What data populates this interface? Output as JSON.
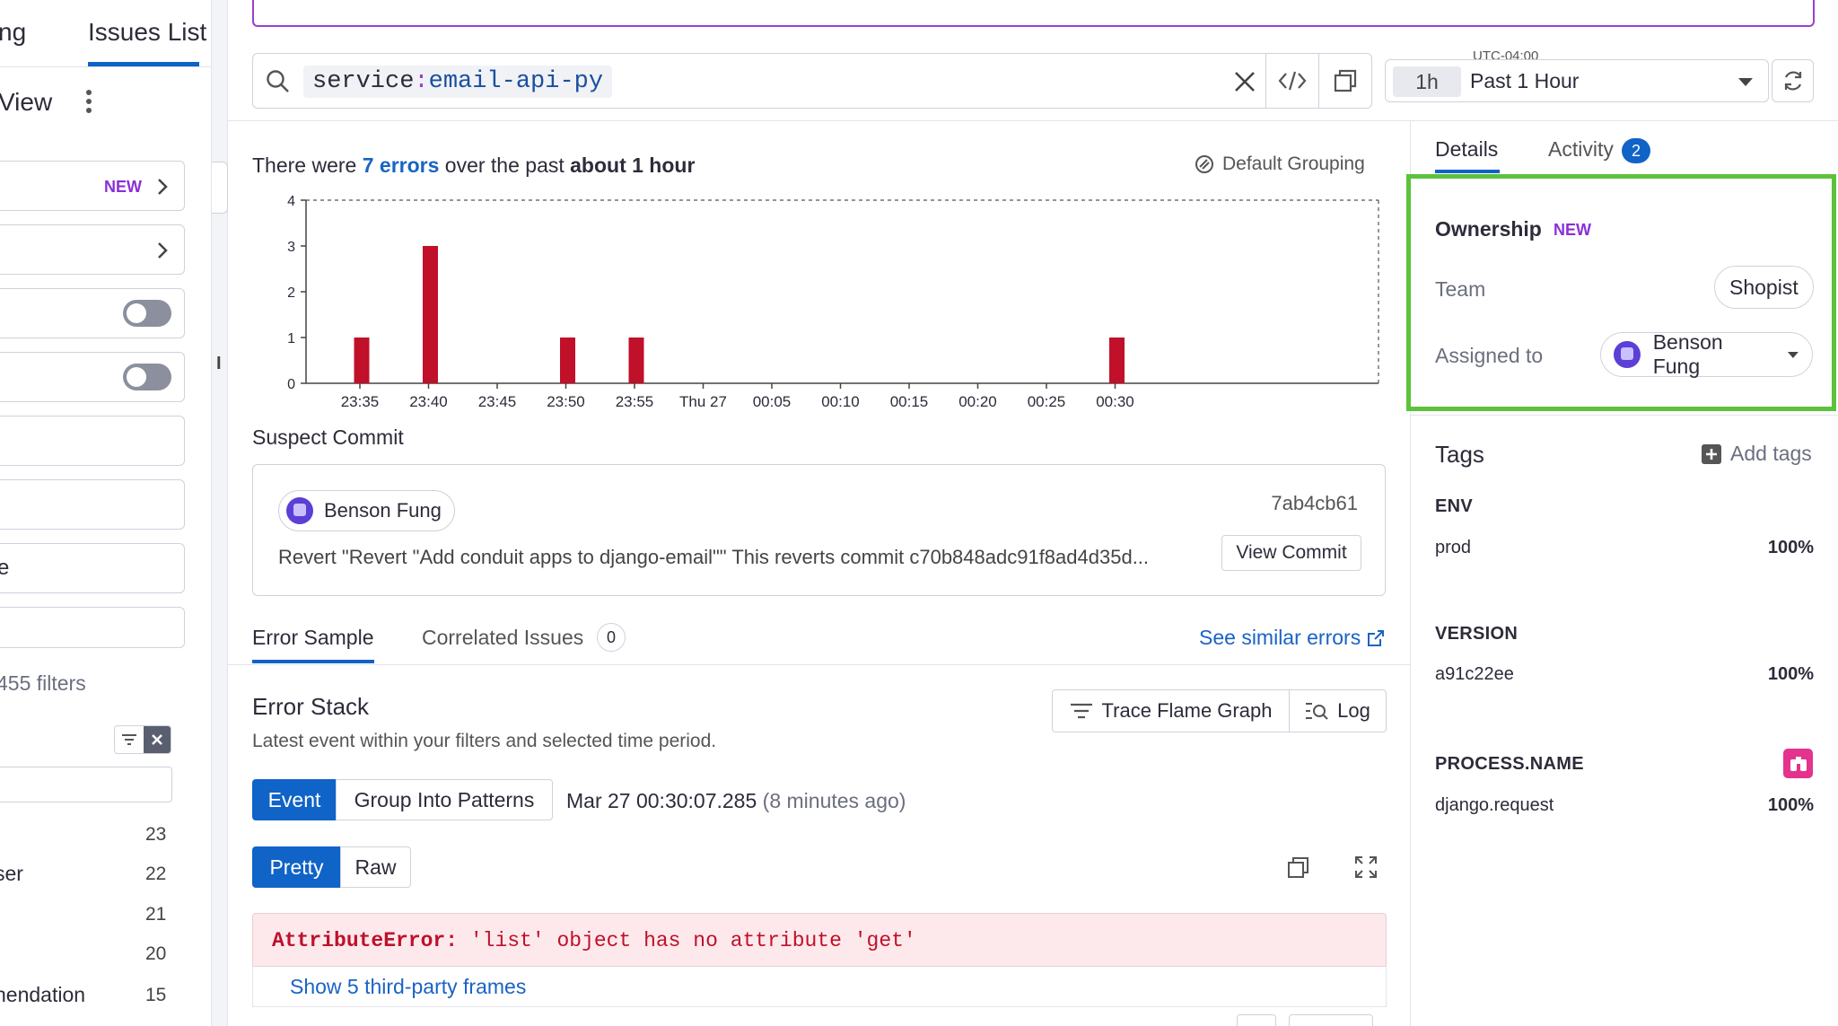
{
  "left_panel": {
    "tab_partial": "ng",
    "tab_issues": "Issues List",
    "view_label": "View",
    "new_badge": "NEW",
    "row_text_e": "e",
    "filters_text": "455 filters",
    "facets": [
      {
        "label": "",
        "count": "23"
      },
      {
        "label": "ser",
        "count": "22"
      },
      {
        "label": "",
        "count": "21"
      },
      {
        "label": "",
        "count": "20"
      },
      {
        "label": "nendation",
        "count": "15"
      }
    ],
    "edge_letter": "I"
  },
  "search": {
    "key": "service",
    "sep": ":",
    "value": "email-api-py"
  },
  "time": {
    "timezone": "UTC-04:00",
    "short": "1h",
    "label": "Past 1 Hour"
  },
  "summary": {
    "prefix": "There were ",
    "count_link": "7 errors",
    "middle": " over the past ",
    "span": "about 1 hour",
    "grouping": "Default Grouping"
  },
  "chart_data": {
    "type": "bar",
    "title": "",
    "xlabel": "",
    "ylabel": "",
    "ylim": [
      0,
      4
    ],
    "yticks": [
      "0",
      "1",
      "2",
      "3",
      "4"
    ],
    "xticks": [
      "23:35",
      "23:40",
      "23:45",
      "23:50",
      "23:55",
      "Thu 27",
      "00:05",
      "00:10",
      "00:15",
      "00:20",
      "00:25",
      "00:30"
    ],
    "bars": [
      {
        "x_minutes": 0,
        "value": 1
      },
      {
        "x_minutes": 5,
        "value": 3
      },
      {
        "x_minutes": 15,
        "value": 1
      },
      {
        "x_minutes": 20,
        "value": 1
      },
      {
        "x_minutes": 55,
        "value": 1
      }
    ],
    "color": "#c0102a"
  },
  "suspect": {
    "heading": "Suspect Commit",
    "author": "Benson Fung",
    "sha": "7ab4cb61",
    "message": "Revert \"Revert \"Add conduit apps to django-email\"\" This reverts commit c70b848adc91f8ad4d35d...",
    "view_button": "View Commit"
  },
  "tabs": {
    "error_sample": "Error Sample",
    "correlated": "Correlated Issues",
    "correlated_count": "0",
    "see_similar": "See similar errors"
  },
  "stack": {
    "title": "Error Stack",
    "subtitle": "Latest event within your filters and selected time period.",
    "flame_button": "Trace Flame Graph",
    "log_button": "Log",
    "mode_event": "Event",
    "mode_patterns": "Group Into Patterns",
    "event_time": "Mar 27 00:30:07.285",
    "event_ago": "(8 minutes ago)",
    "fmt_pretty": "Pretty",
    "fmt_raw": "Raw",
    "error_type": "AttributeError:",
    "error_msg": " 'list' object has no attribute 'get'",
    "frames_link": "Show 5 third-party frames"
  },
  "right": {
    "tab_details": "Details",
    "tab_activity": "Activity",
    "activity_count": "2",
    "ownership": "Ownership",
    "ownership_badge": "NEW",
    "team_label": "Team",
    "team_value": "Shopist",
    "assigned_label": "Assigned to",
    "assigned_value": "Benson Fung",
    "tags_title": "Tags",
    "add_tags": "Add tags",
    "tags": [
      {
        "key": "ENV",
        "value": "prod",
        "pct": "100%"
      },
      {
        "key": "VERSION",
        "value": "a91c22ee",
        "pct": "100%"
      },
      {
        "key": "PROCESS.NAME",
        "value": "django.request",
        "pct": "100%"
      }
    ]
  },
  "colors": {
    "accent_blue": "#1063c7",
    "highlight_green": "#5cc23b",
    "badge_purple": "#8b2fd6",
    "error_red": "#c0102a",
    "error_bg": "#fde9ec"
  }
}
